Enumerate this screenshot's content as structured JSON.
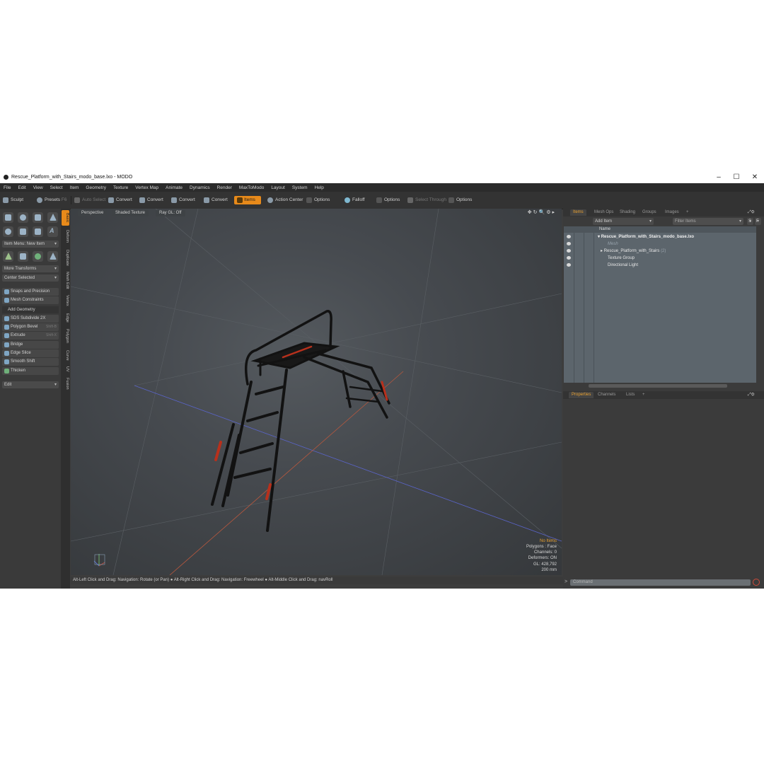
{
  "window": {
    "title": "Rescue_Platform_with_Stairs_modo_base.lxo - MODO"
  },
  "menu": [
    "File",
    "Edit",
    "View",
    "Select",
    "Item",
    "Geometry",
    "Texture",
    "Vertex Map",
    "Animate",
    "Dynamics",
    "Render",
    "MaxToModo",
    "Layout",
    "System",
    "Help"
  ],
  "toolbar": {
    "sculpt": "Sculpt",
    "presets": "Presets",
    "presets_key": "F6",
    "auto_select": "Auto Select",
    "convert1": "Convert",
    "convert2": "Convert",
    "convert3": "Convert",
    "convert4": "Convert",
    "items": "Items",
    "action_center": "Action Center",
    "options1": "Options",
    "falloff": "Falloff",
    "options2": "Options",
    "select_through": "Select Through",
    "options3": "Options"
  },
  "left": {
    "item_menu": "Item Menu: New Item",
    "more_transforms": "More Transforms",
    "center_selected": "Center Selected",
    "snaps": "Snaps and Precision",
    "mesh_constraints": "Mesh Constraints",
    "add_geometry": "Add Geometry",
    "tools": [
      {
        "label": "SDS Subdivide 2X",
        "key": ""
      },
      {
        "label": "Polygon Bevel",
        "key": "Shift-B"
      },
      {
        "label": "Extrude",
        "key": "Shift-X"
      },
      {
        "label": "Bridge",
        "key": ""
      },
      {
        "label": "Edge Slice",
        "key": ""
      },
      {
        "label": "Smooth Shift",
        "key": ""
      },
      {
        "label": "Thicken",
        "key": ""
      }
    ],
    "edit_dropdown": "Edit",
    "vtabs": [
      "Basic",
      "Deform",
      "Duplicate",
      "Mesh Edit",
      "Vertex",
      "Edge",
      "Polygon",
      "Curve",
      "UV",
      "Fusion"
    ]
  },
  "viewport": {
    "perspective": "Perspective",
    "shading": "Shaded Texture",
    "raygl": "Ray GL: Off",
    "stats": {
      "no_items": "No Items",
      "polygons": "Polygons : Face",
      "channels": "Channels: 0",
      "deformers": "Deformers: ON",
      "gl": "GL: 428,792",
      "scale": "200 mm"
    }
  },
  "statusbar": "Alt-Left Click and Drag: Navigation: Rotate (or Pan) ● Alt-Right Click and Drag: Navigation: Freewheel ● Alt-Middle Click and Drag: navRoll",
  "items_panel": {
    "tabs": [
      "Items",
      "Mesh Ops",
      "Shading",
      "Groups",
      "Images",
      "+"
    ],
    "add_item": "Add Item",
    "filter_placeholder": "Filter Items",
    "filter_s": "S",
    "filter_f": "F",
    "name_header": "Name",
    "rows": [
      {
        "label": "Rescue_Platform_with_Stairs_modo_base.lxo"
      },
      {
        "label": "Mesh"
      },
      {
        "label": "Rescue_Platform_with_Stairs",
        "extra": "(2)"
      },
      {
        "label": "Texture Group"
      },
      {
        "label": "Directional Light"
      }
    ]
  },
  "properties_panel": {
    "tabs": [
      "Properties",
      "Channels",
      "Lists",
      "+"
    ]
  },
  "command": {
    "prompt": ">",
    "placeholder": "Command"
  }
}
